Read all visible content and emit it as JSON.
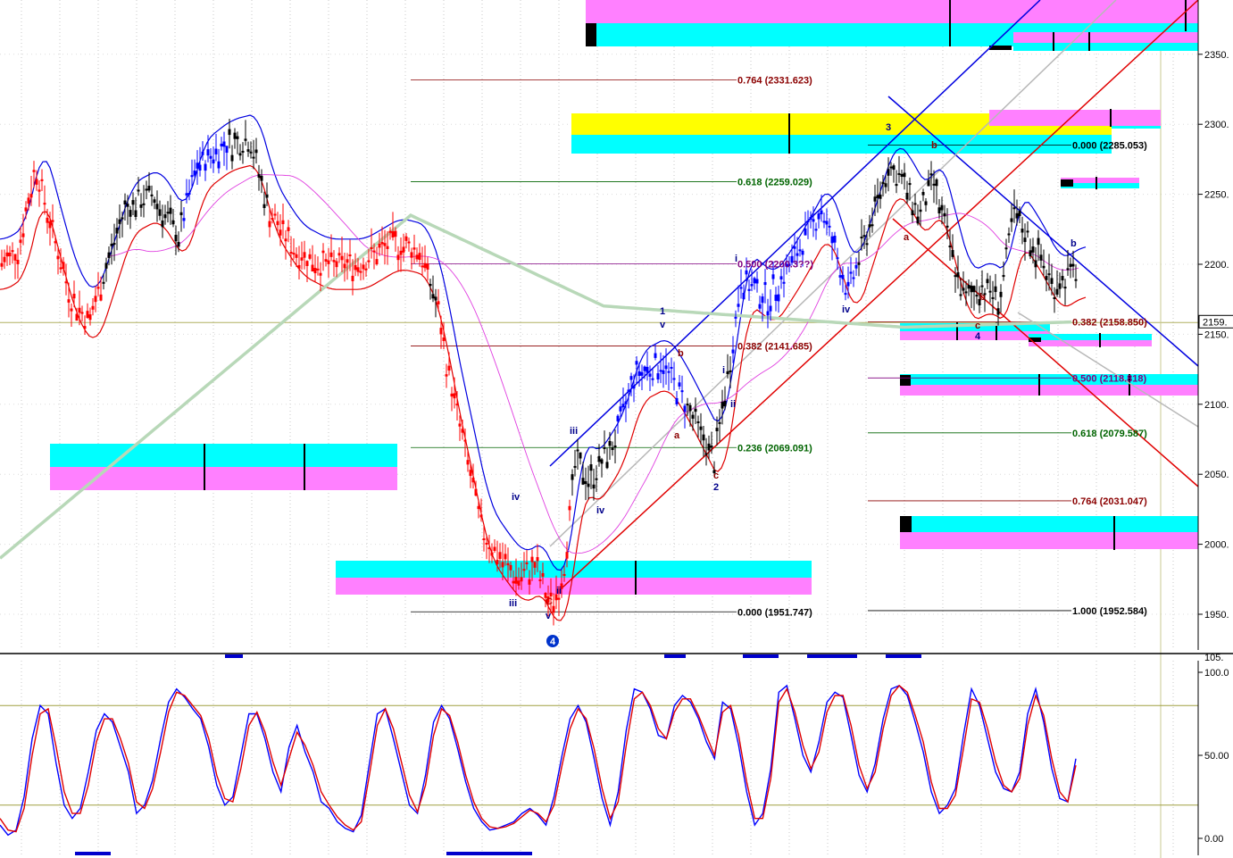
{
  "chart_data": [
    {
      "type": "candlestick",
      "axis": {
        "ylim": [
          1925,
          2375
        ],
        "ticks": [
          1950,
          2000,
          2050,
          2100,
          2150,
          2200,
          2250,
          2300,
          2350
        ],
        "tick_labels": [
          "1950.",
          "2000.",
          "2050.",
          "2100.",
          "2150.",
          "2200.",
          "2250.",
          "2300.",
          "2350."
        ],
        "current_price": 2159,
        "current_price_label": "2159.",
        "grid": "dotted-vertical"
      },
      "fib_left": [
        {
          "text": "0.764 (2331.623)",
          "value": 2331.623,
          "color": "#8b0000"
        },
        {
          "text": "0.618 (2259.029)",
          "value": 2259.029,
          "color": "#006400"
        },
        {
          "text": "0.500 (2200.3??)",
          "value": 2200.3,
          "color": "#800080"
        },
        {
          "text": "0.382 (2141.685)",
          "value": 2141.685,
          "color": "#8b0000"
        },
        {
          "text": "0.236 (2069.091)",
          "value": 2069.091,
          "color": "#006400"
        },
        {
          "text": "0.000 (1951.747)",
          "value": 1951.747,
          "color": "#000000"
        }
      ],
      "fib_right": [
        {
          "text": "0.000 (2285.053)",
          "value": 2285.053,
          "color": "#000000"
        },
        {
          "text": "0.382 (2158.850)",
          "value": 2158.85,
          "color": "#8b0000"
        },
        {
          "text": "0.500 (2118.818)",
          "value": 2118.818,
          "color": "#800080"
        },
        {
          "text": "0.618 (2079.587)",
          "value": 2079.587,
          "color": "#006400"
        },
        {
          "text": "0.764 (2031.047)",
          "value": 2031.047,
          "color": "#8b0000"
        },
        {
          "text": "1.000 (1952.584)",
          "value": 1952.584,
          "color": "#000000"
        }
      ],
      "wave_labels": [
        {
          "text": "iv",
          "color": "#00008b"
        },
        {
          "text": "iii",
          "color": "#00008b"
        },
        {
          "text": "v",
          "color": "#00008b"
        },
        {
          "text": "ii",
          "color": "#00008b"
        },
        {
          "text": "C",
          "color": "#cc0000"
        },
        {
          "text": "4",
          "color": "#ffffff"
        },
        {
          "text": "iii",
          "color": "#00008b"
        },
        {
          "text": "iv",
          "color": "#00008b"
        },
        {
          "text": "v",
          "color": "#00008b"
        },
        {
          "text": "1",
          "color": "#00008b"
        },
        {
          "text": "b",
          "color": "#8b0000"
        },
        {
          "text": "a",
          "color": "#8b0000"
        },
        {
          "text": "c",
          "color": "#8b0000"
        },
        {
          "text": "2",
          "color": "#00008b"
        },
        {
          "text": "i",
          "color": "#00008b"
        },
        {
          "text": "ii",
          "color": "#00008b"
        },
        {
          "text": "i",
          "color": "#00008b"
        },
        {
          "text": "iv",
          "color": "#00008b"
        },
        {
          "text": "3",
          "color": "#00008b"
        },
        {
          "text": "b",
          "color": "#8b0000"
        },
        {
          "text": "a",
          "color": "#8b0000"
        },
        {
          "text": "c",
          "color": "#8b0000"
        },
        {
          "text": "4",
          "color": "#00008b"
        },
        {
          "text": "b",
          "color": "#8b0000"
        },
        {
          "text": "b",
          "color": "#00008b"
        }
      ]
    },
    {
      "type": "line",
      "ylim": [
        0,
        100
      ],
      "ticks": [
        0,
        50,
        100
      ],
      "tick_labels": [
        "0.00",
        "50.00",
        "100.0"
      ],
      "top_clip_label": "105.",
      "series": [
        {
          "color": "#0000ff",
          "values": [
            8,
            2,
            5,
            25,
            60,
            80,
            75,
            45,
            20,
            12,
            18,
            40,
            65,
            75,
            70,
            55,
            40,
            15,
            20,
            35,
            60,
            82,
            90,
            85,
            78,
            72,
            55,
            32,
            20,
            25,
            50,
            75,
            75,
            60,
            40,
            28,
            55,
            68,
            52,
            40,
            22,
            18,
            10,
            6,
            4,
            14,
            45,
            75,
            78,
            60,
            40,
            20,
            15,
            38,
            70,
            80,
            72,
            54,
            34,
            18,
            10,
            5,
            6,
            8,
            10,
            15,
            18,
            14,
            8,
            25,
            50,
            72,
            80,
            70,
            48,
            24,
            8,
            28,
            65,
            90,
            88,
            78,
            62,
            60,
            80,
            86,
            82,
            72,
            58,
            48,
            82,
            78,
            56,
            28,
            8,
            15,
            42,
            88,
            92,
            72,
            50,
            40,
            58,
            82,
            88,
            85,
            62,
            38,
            28,
            45,
            72,
            90,
            92,
            86,
            70,
            52,
            28,
            15,
            20,
            30,
            62,
            90,
            80,
            60,
            40,
            30,
            28,
            40,
            75,
            90,
            70,
            42,
            24,
            22,
            48
          ]
        },
        {
          "color": "#e00000",
          "values": [
            12,
            5,
            4,
            18,
            50,
            75,
            78,
            55,
            28,
            15,
            15,
            32,
            58,
            72,
            72,
            60,
            45,
            22,
            18,
            30,
            52,
            76,
            88,
            86,
            80,
            74,
            60,
            38,
            24,
            22,
            42,
            68,
            76,
            64,
            46,
            32,
            48,
            64,
            56,
            44,
            28,
            20,
            13,
            8,
            5,
            10,
            38,
            68,
            78,
            66,
            46,
            26,
            16,
            32,
            62,
            78,
            74,
            58,
            38,
            22,
            12,
            7,
            6,
            7,
            9,
            13,
            17,
            15,
            10,
            20,
            44,
            66,
            78,
            72,
            54,
            30,
            12,
            22,
            56,
            84,
            88,
            80,
            66,
            60,
            76,
            84,
            84,
            74,
            62,
            50,
            76,
            80,
            62,
            34,
            12,
            12,
            36,
            82,
            90,
            76,
            56,
            42,
            52,
            76,
            86,
            86,
            68,
            44,
            30,
            40,
            66,
            86,
            92,
            88,
            74,
            58,
            34,
            18,
            18,
            26,
            54,
            84,
            82,
            66,
            46,
            32,
            28,
            36,
            68,
            86,
            74,
            48,
            28,
            22,
            44
          ]
        }
      ]
    }
  ]
}
